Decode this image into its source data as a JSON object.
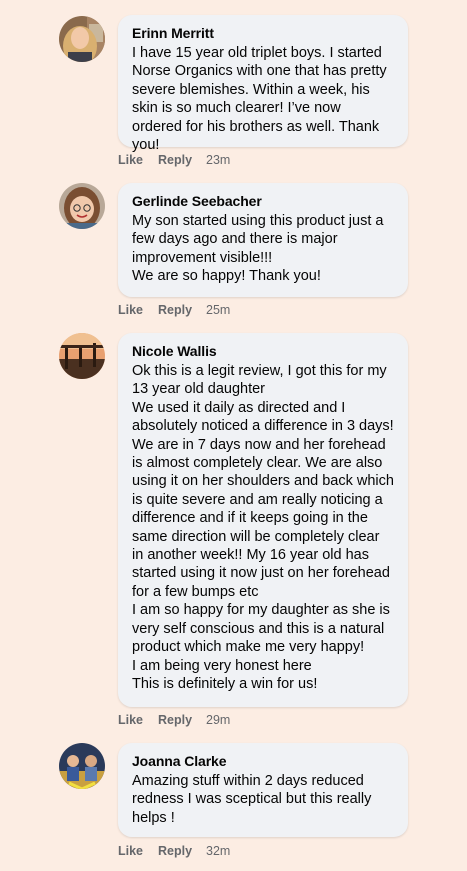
{
  "comments": [
    {
      "author": "Erinn Merritt",
      "text": "I have 15 year old triplet boys. I started Norse Organics with one that has pretty severe blemishes. Within a week, his skin is so much clearer! I’ve now ordered for his brothers as well. Thank you!",
      "like": "Like",
      "reply": "Reply",
      "time": "23m"
    },
    {
      "author": "Gerlinde Seebacher",
      "text": "My son started using this product just a few days ago and there is major improvement visible!!!\nWe are so happy! Thank you!",
      "like": "Like",
      "reply": "Reply",
      "time": "25m"
    },
    {
      "author": "Nicole Wallis",
      "text": "Ok this is a legit review, I got this for my 13 year old daughter\nWe used it daily as directed and I absolutely noticed a difference in 3 days! We are in 7 days now and her forehead is almost completely clear. We are also using it on her shoulders and back which is quite severe and am really noticing a difference and if it keeps going in the same direction will be completely clear in another week!! My 16 year old has started using it now just on her forehead for a few bumps etc\nI am so happy for my daughter as she is very self conscious and this is a natural product which make me very happy!\nI am being very honest here\nThis is definitely a win for us!",
      "like": "Like",
      "reply": "Reply",
      "time": "29m"
    },
    {
      "author": "Joanna Clarke",
      "text": "Amazing stuff within 2 days reduced redness I was sceptical but this really helps !",
      "like": "Like",
      "reply": "Reply",
      "time": "32m"
    }
  ]
}
